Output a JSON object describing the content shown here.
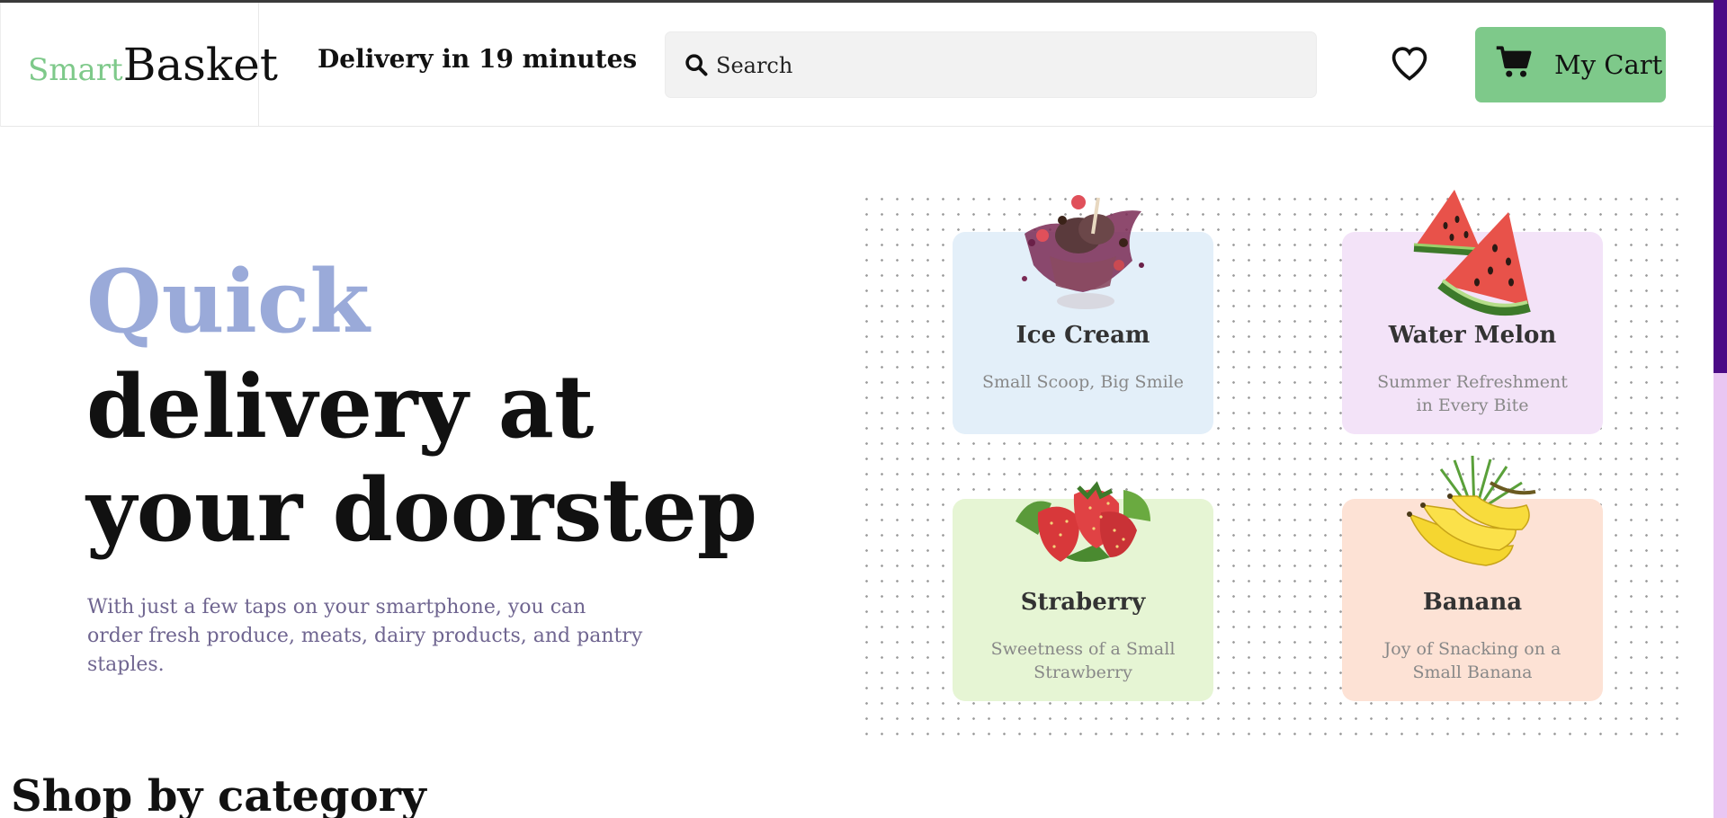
{
  "header": {
    "logo_smart": "Smart",
    "logo_basket": "Basket",
    "delivery_text": "Delivery in 19 minutes",
    "search_placeholder": "Search",
    "cart_label": "My Cart",
    "brand_color": "#7ec98a"
  },
  "hero": {
    "quick": "Quick",
    "line2": "delivery at",
    "line3": "your doorstep",
    "description": "With just a few taps on your smartphone, you can order fresh produce, meats, dairy products, and pantry staples.",
    "accent_color": "#9aaad9"
  },
  "cards": [
    {
      "name": "Ice Cream",
      "subtitle": "Small Scoop, Big Smile",
      "icon": "ice-cream-icon",
      "bg": "#e3eff9"
    },
    {
      "name": "Water Melon",
      "subtitle": "Summer Refreshment in Every Bite",
      "icon": "watermelon-icon",
      "bg": "#f3e3f8"
    },
    {
      "name": "Straberry",
      "subtitle": "Sweetness of a Small Strawberry",
      "icon": "strawberry-icon",
      "bg": "#e6f5d4"
    },
    {
      "name": "Banana",
      "subtitle": "Joy of Snacking on a Small Banana",
      "icon": "banana-icon",
      "bg": "#fde2d5"
    }
  ],
  "section": {
    "shop_title": "Shop by category"
  }
}
